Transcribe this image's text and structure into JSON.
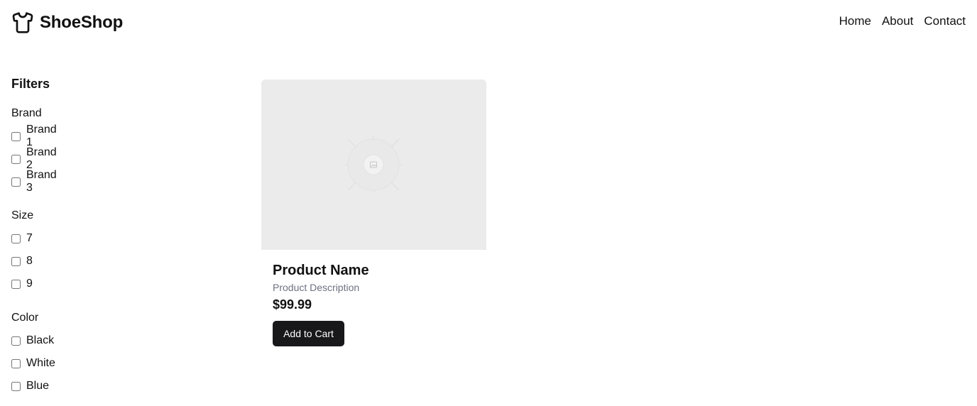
{
  "header": {
    "brand_name": "ShoeShop",
    "brand_icon": "tshirt-icon",
    "nav": [
      {
        "label": "Home"
      },
      {
        "label": "About"
      },
      {
        "label": "Contact"
      }
    ]
  },
  "filters": {
    "title": "Filters",
    "groups": [
      {
        "title": "Brand",
        "options": [
          {
            "label": "Brand 1",
            "checked": false
          },
          {
            "label": "Brand 2",
            "checked": false
          },
          {
            "label": "Brand 3",
            "checked": false
          }
        ]
      },
      {
        "title": "Size",
        "options": [
          {
            "label": "7",
            "checked": false
          },
          {
            "label": "8",
            "checked": false
          },
          {
            "label": "9",
            "checked": false
          }
        ]
      },
      {
        "title": "Color",
        "options": [
          {
            "label": "Black",
            "checked": false
          },
          {
            "label": "White",
            "checked": false
          },
          {
            "label": "Blue",
            "checked": false
          }
        ]
      }
    ]
  },
  "product": {
    "image_icon": "image-placeholder-icon",
    "name": "Product Name",
    "description": "Product Description",
    "price": "$99.99",
    "button_label": "Add to Cart"
  },
  "colors": {
    "button_bg": "#18181b",
    "button_text": "#ffffff",
    "image_bg": "#ebebeb",
    "muted_text": "#6b7280"
  }
}
